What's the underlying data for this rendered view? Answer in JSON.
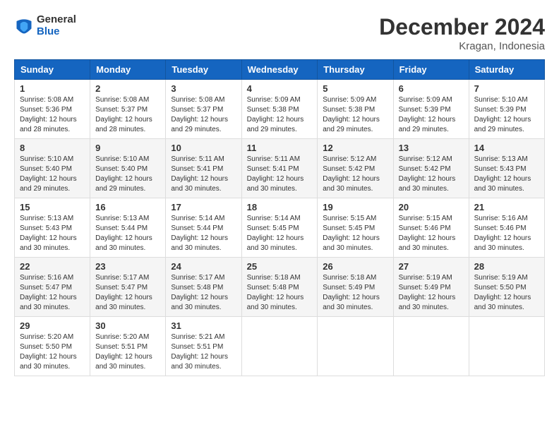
{
  "logo": {
    "line1": "General",
    "line2": "Blue"
  },
  "title": "December 2024",
  "location": "Kragan, Indonesia",
  "headers": [
    "Sunday",
    "Monday",
    "Tuesday",
    "Wednesday",
    "Thursday",
    "Friday",
    "Saturday"
  ],
  "weeks": [
    [
      {
        "day": "1",
        "info": "Sunrise: 5:08 AM\nSunset: 5:36 PM\nDaylight: 12 hours and 28 minutes."
      },
      {
        "day": "2",
        "info": "Sunrise: 5:08 AM\nSunset: 5:37 PM\nDaylight: 12 hours and 28 minutes."
      },
      {
        "day": "3",
        "info": "Sunrise: 5:08 AM\nSunset: 5:37 PM\nDaylight: 12 hours and 29 minutes."
      },
      {
        "day": "4",
        "info": "Sunrise: 5:09 AM\nSunset: 5:38 PM\nDaylight: 12 hours and 29 minutes."
      },
      {
        "day": "5",
        "info": "Sunrise: 5:09 AM\nSunset: 5:38 PM\nDaylight: 12 hours and 29 minutes."
      },
      {
        "day": "6",
        "info": "Sunrise: 5:09 AM\nSunset: 5:39 PM\nDaylight: 12 hours and 29 minutes."
      },
      {
        "day": "7",
        "info": "Sunrise: 5:10 AM\nSunset: 5:39 PM\nDaylight: 12 hours and 29 minutes."
      }
    ],
    [
      {
        "day": "8",
        "info": "Sunrise: 5:10 AM\nSunset: 5:40 PM\nDaylight: 12 hours and 29 minutes."
      },
      {
        "day": "9",
        "info": "Sunrise: 5:10 AM\nSunset: 5:40 PM\nDaylight: 12 hours and 29 minutes."
      },
      {
        "day": "10",
        "info": "Sunrise: 5:11 AM\nSunset: 5:41 PM\nDaylight: 12 hours and 30 minutes."
      },
      {
        "day": "11",
        "info": "Sunrise: 5:11 AM\nSunset: 5:41 PM\nDaylight: 12 hours and 30 minutes."
      },
      {
        "day": "12",
        "info": "Sunrise: 5:12 AM\nSunset: 5:42 PM\nDaylight: 12 hours and 30 minutes."
      },
      {
        "day": "13",
        "info": "Sunrise: 5:12 AM\nSunset: 5:42 PM\nDaylight: 12 hours and 30 minutes."
      },
      {
        "day": "14",
        "info": "Sunrise: 5:13 AM\nSunset: 5:43 PM\nDaylight: 12 hours and 30 minutes."
      }
    ],
    [
      {
        "day": "15",
        "info": "Sunrise: 5:13 AM\nSunset: 5:43 PM\nDaylight: 12 hours and 30 minutes."
      },
      {
        "day": "16",
        "info": "Sunrise: 5:13 AM\nSunset: 5:44 PM\nDaylight: 12 hours and 30 minutes."
      },
      {
        "day": "17",
        "info": "Sunrise: 5:14 AM\nSunset: 5:44 PM\nDaylight: 12 hours and 30 minutes."
      },
      {
        "day": "18",
        "info": "Sunrise: 5:14 AM\nSunset: 5:45 PM\nDaylight: 12 hours and 30 minutes."
      },
      {
        "day": "19",
        "info": "Sunrise: 5:15 AM\nSunset: 5:45 PM\nDaylight: 12 hours and 30 minutes."
      },
      {
        "day": "20",
        "info": "Sunrise: 5:15 AM\nSunset: 5:46 PM\nDaylight: 12 hours and 30 minutes."
      },
      {
        "day": "21",
        "info": "Sunrise: 5:16 AM\nSunset: 5:46 PM\nDaylight: 12 hours and 30 minutes."
      }
    ],
    [
      {
        "day": "22",
        "info": "Sunrise: 5:16 AM\nSunset: 5:47 PM\nDaylight: 12 hours and 30 minutes."
      },
      {
        "day": "23",
        "info": "Sunrise: 5:17 AM\nSunset: 5:47 PM\nDaylight: 12 hours and 30 minutes."
      },
      {
        "day": "24",
        "info": "Sunrise: 5:17 AM\nSunset: 5:48 PM\nDaylight: 12 hours and 30 minutes."
      },
      {
        "day": "25",
        "info": "Sunrise: 5:18 AM\nSunset: 5:48 PM\nDaylight: 12 hours and 30 minutes."
      },
      {
        "day": "26",
        "info": "Sunrise: 5:18 AM\nSunset: 5:49 PM\nDaylight: 12 hours and 30 minutes."
      },
      {
        "day": "27",
        "info": "Sunrise: 5:19 AM\nSunset: 5:49 PM\nDaylight: 12 hours and 30 minutes."
      },
      {
        "day": "28",
        "info": "Sunrise: 5:19 AM\nSunset: 5:50 PM\nDaylight: 12 hours and 30 minutes."
      }
    ],
    [
      {
        "day": "29",
        "info": "Sunrise: 5:20 AM\nSunset: 5:50 PM\nDaylight: 12 hours and 30 minutes."
      },
      {
        "day": "30",
        "info": "Sunrise: 5:20 AM\nSunset: 5:51 PM\nDaylight: 12 hours and 30 minutes."
      },
      {
        "day": "31",
        "info": "Sunrise: 5:21 AM\nSunset: 5:51 PM\nDaylight: 12 hours and 30 minutes."
      },
      {
        "day": "",
        "info": ""
      },
      {
        "day": "",
        "info": ""
      },
      {
        "day": "",
        "info": ""
      },
      {
        "day": "",
        "info": ""
      }
    ]
  ]
}
